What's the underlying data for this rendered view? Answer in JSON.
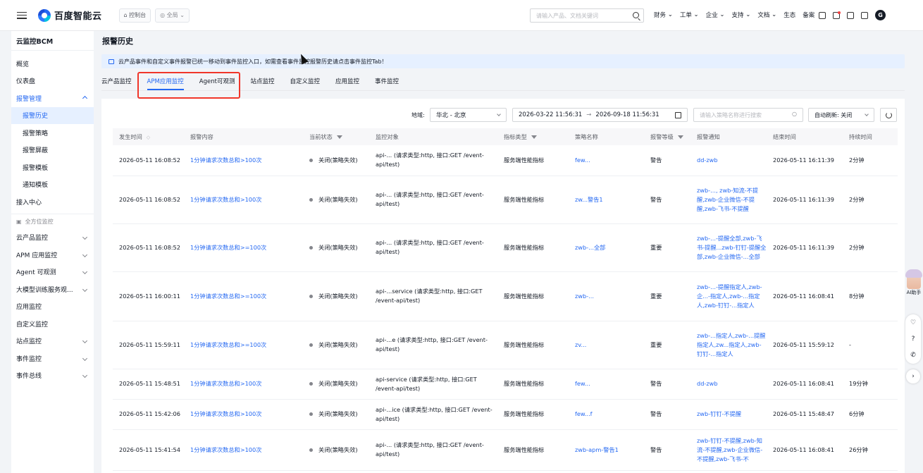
{
  "topbar": {
    "logo_text": "百度智能云",
    "console_label": "控制台",
    "region_label": "全局",
    "search_placeholder": "请输入产品、文档关键词",
    "nav": [
      "财务",
      "工单",
      "企业",
      "支持",
      "文档",
      "生态",
      "备案"
    ],
    "avatar_letter": "G"
  },
  "sidebar": {
    "title": "云监控BCM",
    "items": [
      {
        "label": "概览"
      },
      {
        "label": "仪表盘"
      },
      {
        "label": "报警管理",
        "expanded": true
      },
      {
        "label": "报警历史",
        "sub": true,
        "active": true
      },
      {
        "label": "报警策略",
        "sub": true
      },
      {
        "label": "报警屏蔽",
        "sub": true
      },
      {
        "label": "报警模板",
        "sub": true
      },
      {
        "label": "通知模板",
        "sub": true
      },
      {
        "label": "接入中心"
      }
    ],
    "section_label": "全方位监控",
    "section_items": [
      {
        "label": "云产品监控",
        "chevron": true
      },
      {
        "label": "APM 应用监控",
        "chevron": true
      },
      {
        "label": "Agent 可观测",
        "chevron": true
      },
      {
        "label": "大模型训练服务观...",
        "chevron": true
      },
      {
        "label": "应用监控",
        "chevron": false
      },
      {
        "label": "自定义监控",
        "chevron": false
      },
      {
        "label": "站点监控",
        "chevron": true
      },
      {
        "label": "事件监控",
        "chevron": true
      },
      {
        "label": "事件总线",
        "chevron": true
      }
    ]
  },
  "main": {
    "page_title": "报警历史",
    "notice": "云产品事件和自定义事件报警已统一移动到事件监控入口，如需查看事件监控报警历史请点击事件监控Tab！",
    "tabs": [
      "云产品监控",
      "APM应用监控",
      "Agent可观测",
      "站点监控",
      "自定义监控",
      "应用监控",
      "事件监控"
    ],
    "active_tab": 1,
    "filters": {
      "region_label": "地域:",
      "region_value": "华北 - 北京",
      "date_start": "2026-03-22 11:56:31",
      "date_sep": "→",
      "date_end": "2026-09-18 11:56:31",
      "search_placeholder": "请输入策略名称进行搜索",
      "auto_refresh": "自动刷新: 关闭"
    },
    "table": {
      "columns": [
        "发生时间",
        "报警内容",
        "当前状态",
        "监控对象",
        "指标类型",
        "策略名称",
        "报警等级",
        "报警通知",
        "结束时间",
        "持续时间"
      ],
      "rows": [
        {
          "time": "2026-05-11 16:08:52",
          "content": "1分钟请求次数总和>100次",
          "status": "关闭(策略失效)",
          "object": "api-... (请求类型:http, 接口:GET /event-api/test)",
          "metric": "服务端性能指标",
          "policy": "few...",
          "level": "警告",
          "notify": "dd-zwb",
          "end": "2026-05-11 16:11:39",
          "duration": "2分钟"
        },
        {
          "time": "2026-05-11 16:08:52",
          "content": "1分钟请求次数总和>100次",
          "status": "关闭(策略失效)",
          "object": "api-... (请求类型:http, 接口:GET /event-api/test)",
          "metric": "服务端性能指标",
          "policy": "zw...警告1",
          "level": "警告",
          "notify": "zwb-..., zwb-知流-不提醒,zwb-企业微信-不提醒,zwb-飞书-不提醒",
          "end": "2026-05-11 16:11:39",
          "duration": "2分钟"
        },
        {
          "time": "2026-05-11 16:08:52",
          "content": "1分钟请求次数总和>=100次",
          "status": "关闭(策略失效)",
          "object": "api-... (请求类型:http, 接口:GET /event-api/test)",
          "metric": "服务端性能指标",
          "policy": "zwb-...全部",
          "level": "重要",
          "notify": "zwb-...-提醒全部,zwb-飞书-提醒...zwb-钉钉-提醒全部,zwb-企业微信-...全部",
          "end": "2026-05-11 16:11:39",
          "duration": "2分钟"
        },
        {
          "time": "2026-05-11 16:00:11",
          "content": "1分钟请求次数总和>=100次",
          "status": "关闭(策略失效)",
          "object": "api-...service (请求类型:http, 接口:GET /event-api/test)",
          "metric": "服务端性能指标",
          "policy": "zwb-...",
          "level": "重要",
          "notify": "zwb-...-提醒指定人,zwb-企...-指定人,zwb-...指定人,zwb-钉钉-...指定人",
          "end": "2026-05-11 16:08:41",
          "duration": "8分钟"
        },
        {
          "time": "2026-05-11 15:59:11",
          "content": "1分钟请求次数总和>=100次",
          "status": "关闭(策略失效)",
          "object": "api-...e (请求类型:http, 接口:GET /event-api/test)",
          "metric": "服务端性能指标",
          "policy": "zv...",
          "level": "重要",
          "notify": "zwb-...指定人,zwb-...提醒指定人,zw...指定人,zwb-钉钉-...指定人",
          "end": "2026-05-11 15:59:12",
          "duration": "-"
        },
        {
          "time": "2026-05-11 15:48:51",
          "content": "1分钟请求次数总和>100次",
          "status": "关闭(策略失效)",
          "object": "api-service (请求类型:http, 接口:GET /event-api/test)",
          "metric": "服务端性能指标",
          "policy": "few...",
          "level": "警告",
          "notify": "dd-zwb",
          "end": "2026-05-11 16:08:41",
          "duration": "19分钟"
        },
        {
          "time": "2026-05-11 15:42:06",
          "content": "1分钟请求次数总和>100次",
          "status": "关闭(策略失效)",
          "object": "api-...ice (请求类型:http, 接口:GET /event-api/test)",
          "metric": "服务端性能指标",
          "policy": "few...f",
          "level": "警告",
          "notify": "zwb-钉钉-不提醒",
          "end": "2026-05-11 15:48:47",
          "duration": "6分钟"
        },
        {
          "time": "2026-05-11 15:41:54",
          "content": "1分钟请求次数总和>100次",
          "status": "关闭(策略失效)",
          "object": "api-... (请求类型:http, 接口:GET /event-api/test)",
          "metric": "服务端性能指标",
          "policy": "zwb-apm-警告1",
          "level": "警告",
          "notify": "zwb-钉钉-不提醒,zwb-知流-不提醒,zwb-企业微信-不提醒,zwb-飞书-不",
          "end": "2026-05-11 16:08:41",
          "duration": "26分钟"
        }
      ]
    }
  },
  "rail": {
    "helper_label": "AI助手"
  }
}
